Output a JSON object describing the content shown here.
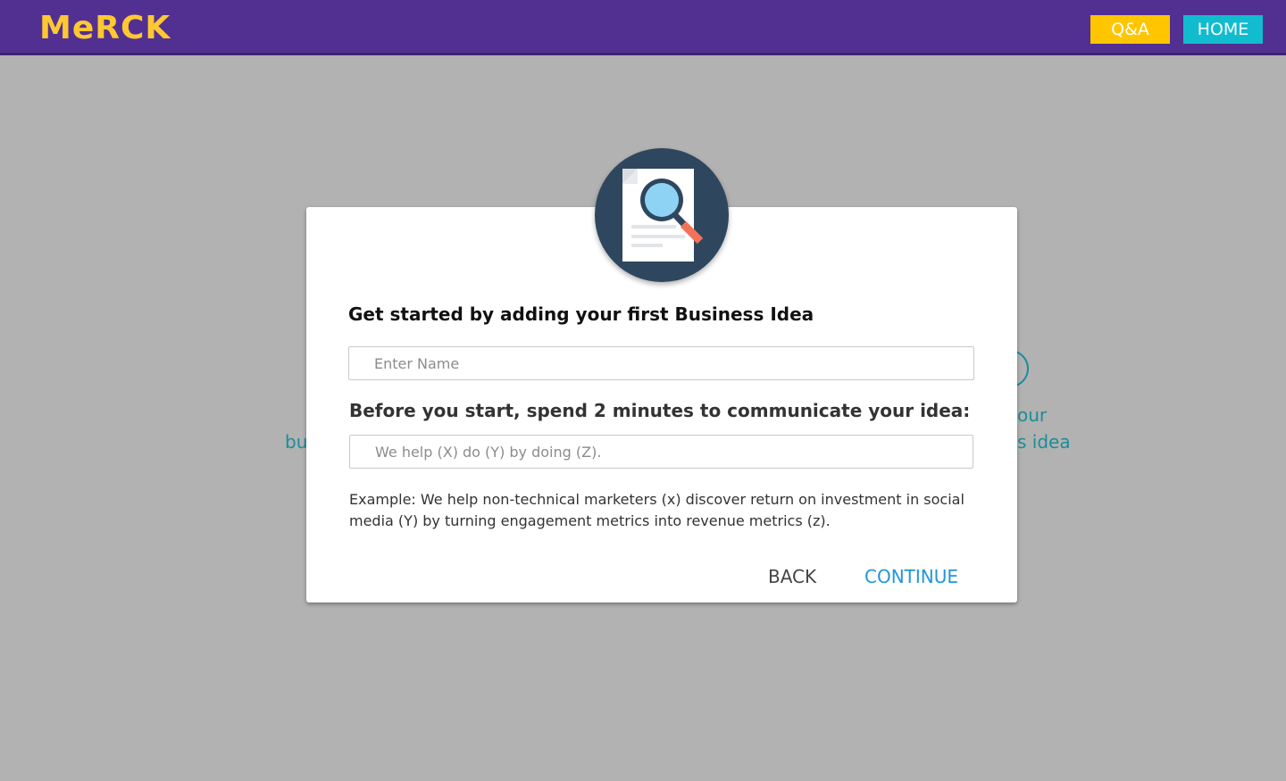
{
  "header": {
    "logo_text": "MeRCK",
    "qa_label": "Q&A",
    "home_label": "HOME"
  },
  "background": {
    "left_fragment_top": "",
    "left_fragment_bottom": "bu",
    "right_fragment_top": "our",
    "right_fragment_bottom": "s idea"
  },
  "dialog": {
    "icon": "document-search-icon",
    "title": "Get started by adding your first Business Idea",
    "name_placeholder": "Enter Name",
    "subtitle": "Before you start, spend 2 minutes to communicate your idea:",
    "idea_placeholder": "We help (X) do (Y) by doing (Z).",
    "example": "Example: We help non-technical marketers (x) discover return on investment in social media (Y) by turning engagement metrics into revenue metrics (z).",
    "back_label": "BACK",
    "continue_label": "CONTINUE"
  },
  "colors": {
    "header_bg": "#523092",
    "logo": "#ffc832",
    "qa_button": "#ffc600",
    "home_button": "#12bccf",
    "overlay": "#b2b2b2",
    "accent_link": "#2196d9",
    "badge_bg": "#2e475e"
  }
}
